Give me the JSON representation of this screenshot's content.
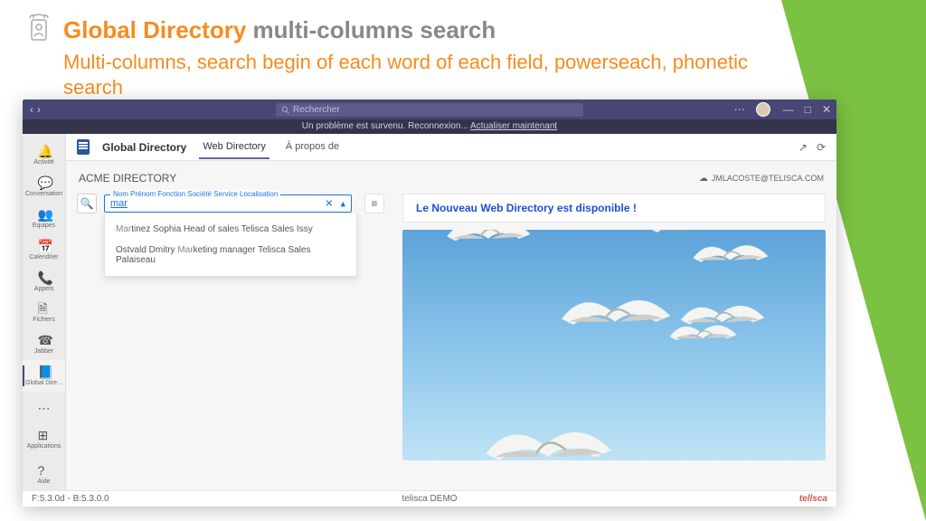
{
  "slide": {
    "title_strong": "Global Directory",
    "title_sub": "multi-columns search",
    "subtitle": "Multi-columns, search begin of each word of each field, powerseach, phonetic search"
  },
  "titlebar": {
    "search_placeholder": "Rechercher",
    "dots": "⋯",
    "min": "—",
    "max": "□",
    "close": "✕"
  },
  "errorbar": {
    "msg": "Un problème est survenu. Reconnexion...",
    "link": "Actualiser maintenant"
  },
  "rail": {
    "items": [
      {
        "label": "Activité"
      },
      {
        "label": "Conversation"
      },
      {
        "label": "Equipes"
      },
      {
        "label": "Calendrier"
      },
      {
        "label": "Appels"
      },
      {
        "label": "Fichiers"
      },
      {
        "label": "Jabber"
      },
      {
        "label": "Global Dire..."
      },
      {
        "label": "⋯"
      }
    ],
    "apps_label": "Applications",
    "help_label": "Aide"
  },
  "apphdr": {
    "name": "Global Directory",
    "tab_active": "Web Directory",
    "tab_about": "À propos de"
  },
  "directory": {
    "title": "ACME DIRECTORY",
    "user_email": "JMLACOSTE@TELISCA.COM"
  },
  "search": {
    "label": "Nom Prénom Fonction Société Service Localisation",
    "value": "mar",
    "clear": "✕",
    "caret": "▴",
    "results": [
      {
        "pre": "Mar",
        "rest": "tinez Sophia Head of sales Telisca Sales Issy"
      },
      {
        "pre": "Ostvald Dmitry ",
        "hl": "Mar",
        "rest": "keting manager Telisca Sales Palaiseau"
      }
    ]
  },
  "banner": "Le Nouveau Web Directory est disponible !",
  "status": {
    "version": "F:5.3.0d - B:5.3.0.0",
    "center": "telisca DEMO",
    "brand": "tellsca"
  }
}
